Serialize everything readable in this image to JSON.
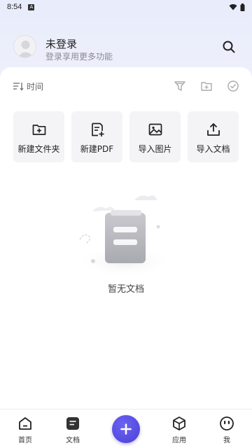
{
  "status_bar": {
    "time": "8:54",
    "app_badge": "A"
  },
  "header": {
    "username": "未登录",
    "subtitle": "登录享用更多功能"
  },
  "toolbar": {
    "sort_label": "时间"
  },
  "actions": [
    {
      "label": "新建文件夹",
      "icon": "folder-add-icon"
    },
    {
      "label": "新建PDF",
      "icon": "pdf-new-icon"
    },
    {
      "label": "导入图片",
      "icon": "image-icon"
    },
    {
      "label": "导入文档",
      "icon": "upload-icon"
    }
  ],
  "empty_state": {
    "text": "暂无文档"
  },
  "bottom_nav": [
    {
      "label": "首页",
      "icon": "home-icon"
    },
    {
      "label": "文档",
      "icon": "document-icon"
    },
    {
      "label": "",
      "icon": "add-icon"
    },
    {
      "label": "应用",
      "icon": "cube-icon"
    },
    {
      "label": "我",
      "icon": "smiley-icon"
    }
  ],
  "colors": {
    "accent": "#5548e4",
    "card_bg": "#f4f4f6"
  }
}
